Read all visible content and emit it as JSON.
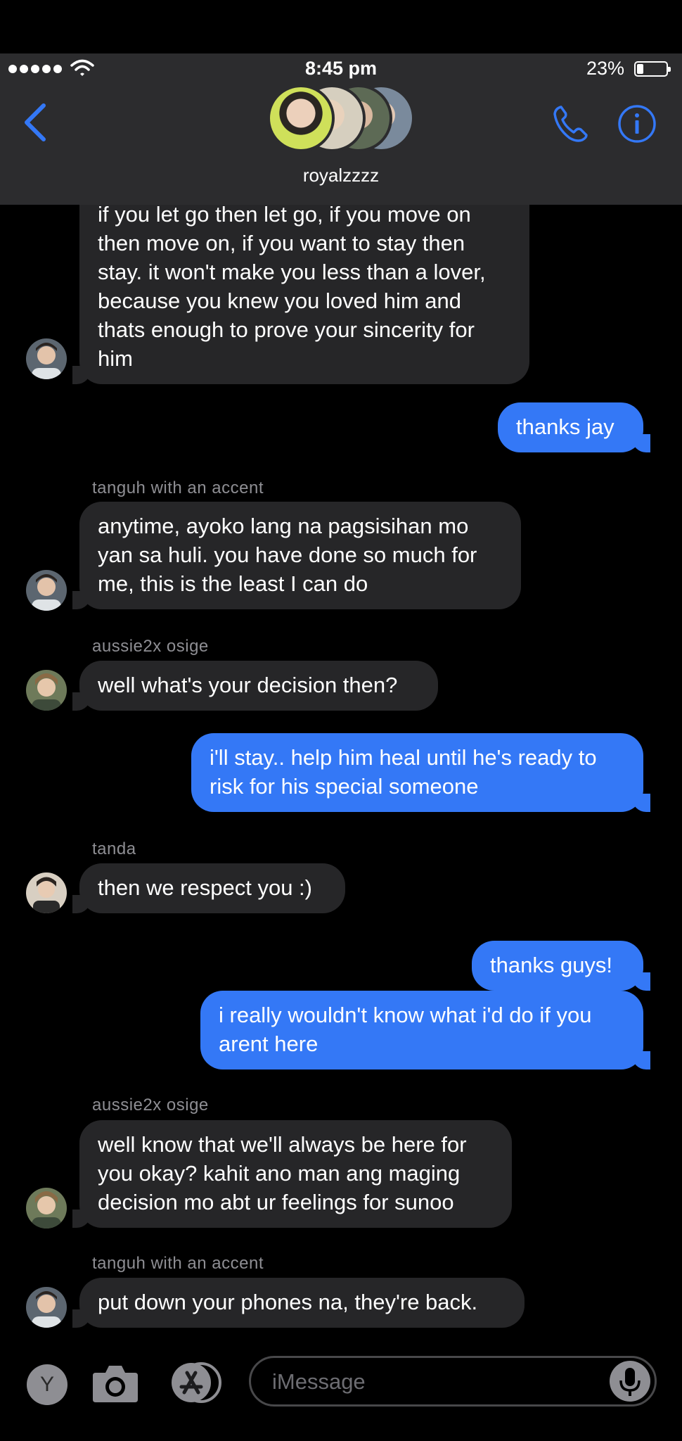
{
  "status": {
    "time": "8:45 pm",
    "battery": "23%",
    "battery_level": 0.23
  },
  "header": {
    "group_name": "royalzzzz"
  },
  "messages": [
    {
      "type": "in",
      "text": "if you let go then let go, if you move on then move on, if you want to stay then stay. it won't make you less than a lover, because you knew you loved him and thats enough to prove your sincerity for him"
    },
    {
      "type": "out",
      "text": "thanks jay"
    },
    {
      "type": "in",
      "sender": "tanguh with an accent",
      "text": "anytime, ayoko lang na pagsisihan mo yan sa huli. you have done so much for me, this is the least I can do"
    },
    {
      "type": "in",
      "sender": "aussie2x osige",
      "text": "well what's your decision then?"
    },
    {
      "type": "out",
      "text": "i'll stay.. help him heal until he's ready to risk for his special someone"
    },
    {
      "type": "in",
      "sender": "tanda",
      "text": "then we respect you :)"
    },
    {
      "type": "out",
      "text": "thanks guys!"
    },
    {
      "type": "out",
      "text": "i really wouldn't know what i'd do if you arent here"
    },
    {
      "type": "in",
      "sender": "aussie2x osige",
      "text": "well know that we'll always be here for you okay? kahit ano man ang maging decision mo abt ur feelings for sunoo"
    },
    {
      "type": "in",
      "sender": "tanguh with an accent",
      "text": "put down your phones na, they're back."
    }
  ],
  "input": {
    "placeholder": "iMessage",
    "apps_letter": "Y"
  },
  "colors": {
    "outgoing": "#3478f6",
    "incoming": "#262628",
    "accent": "#3478f6"
  }
}
